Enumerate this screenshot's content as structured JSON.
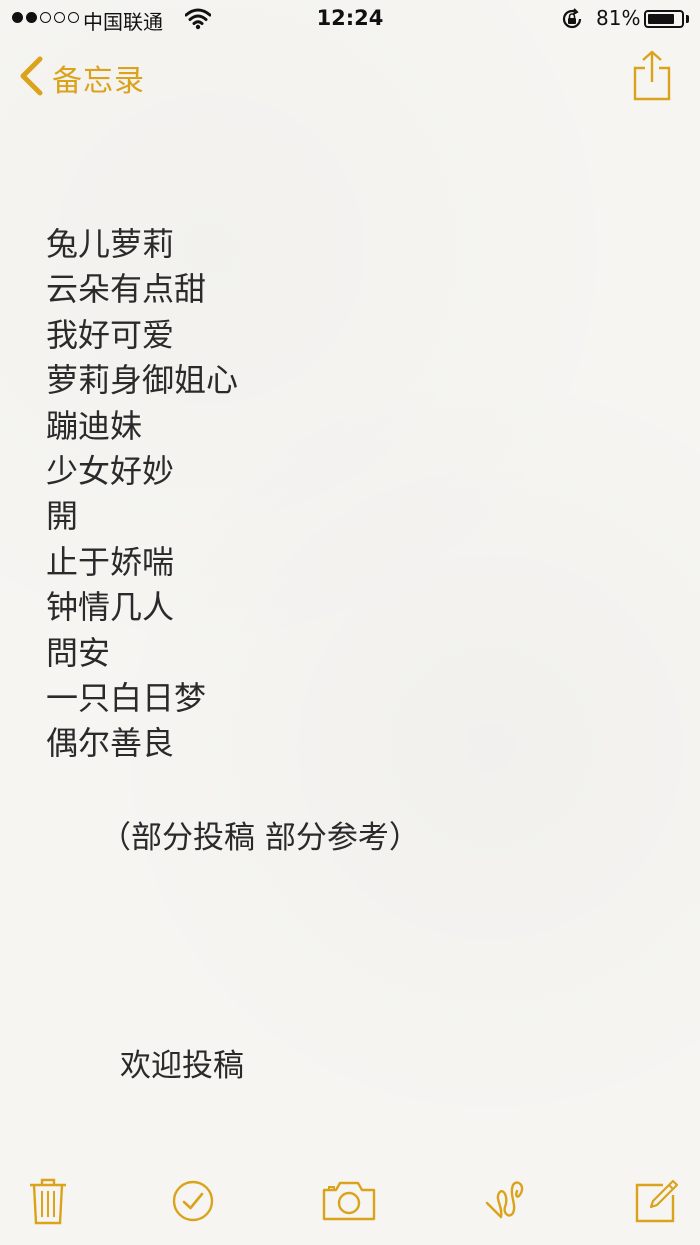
{
  "status_bar": {
    "signal_dots_filled": 2,
    "signal_dots_total": 5,
    "carrier": "中国联通",
    "time": "12:24",
    "battery_percent": "81%",
    "battery_level": 0.81
  },
  "nav": {
    "back_label": "备忘录",
    "accent_color": "#dba31c"
  },
  "note": {
    "lines": [
      "兔儿萝莉",
      "云朵有点甜",
      "我好可爱",
      "萝莉身御姐心",
      "蹦迪妹",
      "少女好妙",
      "開",
      "止于娇喘",
      "钟情几人",
      "問安",
      "一只白日梦",
      "偶尔善良"
    ],
    "source": "（部分投稿  部分参考）",
    "welcome": "欢迎投稿"
  },
  "icons": {
    "back": "chevron-left-icon",
    "share": "share-icon",
    "trash": "trash-icon",
    "checklist": "checkmark-circle-icon",
    "camera": "camera-icon",
    "sketch": "sketch-squiggle-icon",
    "compose": "compose-icon"
  }
}
